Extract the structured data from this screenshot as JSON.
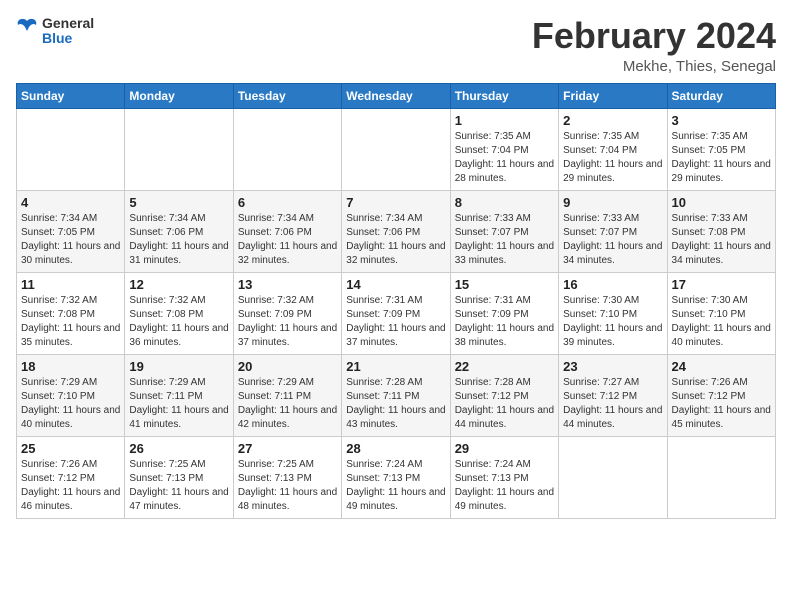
{
  "logo": {
    "text_general": "General",
    "text_blue": "Blue"
  },
  "header": {
    "month_year": "February 2024",
    "location": "Mekhe, Thies, Senegal"
  },
  "days_of_week": [
    "Sunday",
    "Monday",
    "Tuesday",
    "Wednesday",
    "Thursday",
    "Friday",
    "Saturday"
  ],
  "weeks": [
    [
      {
        "day": "",
        "info": ""
      },
      {
        "day": "",
        "info": ""
      },
      {
        "day": "",
        "info": ""
      },
      {
        "day": "",
        "info": ""
      },
      {
        "day": "1",
        "info": "Sunrise: 7:35 AM\nSunset: 7:04 PM\nDaylight: 11 hours and 28 minutes."
      },
      {
        "day": "2",
        "info": "Sunrise: 7:35 AM\nSunset: 7:04 PM\nDaylight: 11 hours and 29 minutes."
      },
      {
        "day": "3",
        "info": "Sunrise: 7:35 AM\nSunset: 7:05 PM\nDaylight: 11 hours and 29 minutes."
      }
    ],
    [
      {
        "day": "4",
        "info": "Sunrise: 7:34 AM\nSunset: 7:05 PM\nDaylight: 11 hours and 30 minutes."
      },
      {
        "day": "5",
        "info": "Sunrise: 7:34 AM\nSunset: 7:06 PM\nDaylight: 11 hours and 31 minutes."
      },
      {
        "day": "6",
        "info": "Sunrise: 7:34 AM\nSunset: 7:06 PM\nDaylight: 11 hours and 32 minutes."
      },
      {
        "day": "7",
        "info": "Sunrise: 7:34 AM\nSunset: 7:06 PM\nDaylight: 11 hours and 32 minutes."
      },
      {
        "day": "8",
        "info": "Sunrise: 7:33 AM\nSunset: 7:07 PM\nDaylight: 11 hours and 33 minutes."
      },
      {
        "day": "9",
        "info": "Sunrise: 7:33 AM\nSunset: 7:07 PM\nDaylight: 11 hours and 34 minutes."
      },
      {
        "day": "10",
        "info": "Sunrise: 7:33 AM\nSunset: 7:08 PM\nDaylight: 11 hours and 34 minutes."
      }
    ],
    [
      {
        "day": "11",
        "info": "Sunrise: 7:32 AM\nSunset: 7:08 PM\nDaylight: 11 hours and 35 minutes."
      },
      {
        "day": "12",
        "info": "Sunrise: 7:32 AM\nSunset: 7:08 PM\nDaylight: 11 hours and 36 minutes."
      },
      {
        "day": "13",
        "info": "Sunrise: 7:32 AM\nSunset: 7:09 PM\nDaylight: 11 hours and 37 minutes."
      },
      {
        "day": "14",
        "info": "Sunrise: 7:31 AM\nSunset: 7:09 PM\nDaylight: 11 hours and 37 minutes."
      },
      {
        "day": "15",
        "info": "Sunrise: 7:31 AM\nSunset: 7:09 PM\nDaylight: 11 hours and 38 minutes."
      },
      {
        "day": "16",
        "info": "Sunrise: 7:30 AM\nSunset: 7:10 PM\nDaylight: 11 hours and 39 minutes."
      },
      {
        "day": "17",
        "info": "Sunrise: 7:30 AM\nSunset: 7:10 PM\nDaylight: 11 hours and 40 minutes."
      }
    ],
    [
      {
        "day": "18",
        "info": "Sunrise: 7:29 AM\nSunset: 7:10 PM\nDaylight: 11 hours and 40 minutes."
      },
      {
        "day": "19",
        "info": "Sunrise: 7:29 AM\nSunset: 7:11 PM\nDaylight: 11 hours and 41 minutes."
      },
      {
        "day": "20",
        "info": "Sunrise: 7:29 AM\nSunset: 7:11 PM\nDaylight: 11 hours and 42 minutes."
      },
      {
        "day": "21",
        "info": "Sunrise: 7:28 AM\nSunset: 7:11 PM\nDaylight: 11 hours and 43 minutes."
      },
      {
        "day": "22",
        "info": "Sunrise: 7:28 AM\nSunset: 7:12 PM\nDaylight: 11 hours and 44 minutes."
      },
      {
        "day": "23",
        "info": "Sunrise: 7:27 AM\nSunset: 7:12 PM\nDaylight: 11 hours and 44 minutes."
      },
      {
        "day": "24",
        "info": "Sunrise: 7:26 AM\nSunset: 7:12 PM\nDaylight: 11 hours and 45 minutes."
      }
    ],
    [
      {
        "day": "25",
        "info": "Sunrise: 7:26 AM\nSunset: 7:12 PM\nDaylight: 11 hours and 46 minutes."
      },
      {
        "day": "26",
        "info": "Sunrise: 7:25 AM\nSunset: 7:13 PM\nDaylight: 11 hours and 47 minutes."
      },
      {
        "day": "27",
        "info": "Sunrise: 7:25 AM\nSunset: 7:13 PM\nDaylight: 11 hours and 48 minutes."
      },
      {
        "day": "28",
        "info": "Sunrise: 7:24 AM\nSunset: 7:13 PM\nDaylight: 11 hours and 49 minutes."
      },
      {
        "day": "29",
        "info": "Sunrise: 7:24 AM\nSunset: 7:13 PM\nDaylight: 11 hours and 49 minutes."
      },
      {
        "day": "",
        "info": ""
      },
      {
        "day": "",
        "info": ""
      }
    ]
  ]
}
